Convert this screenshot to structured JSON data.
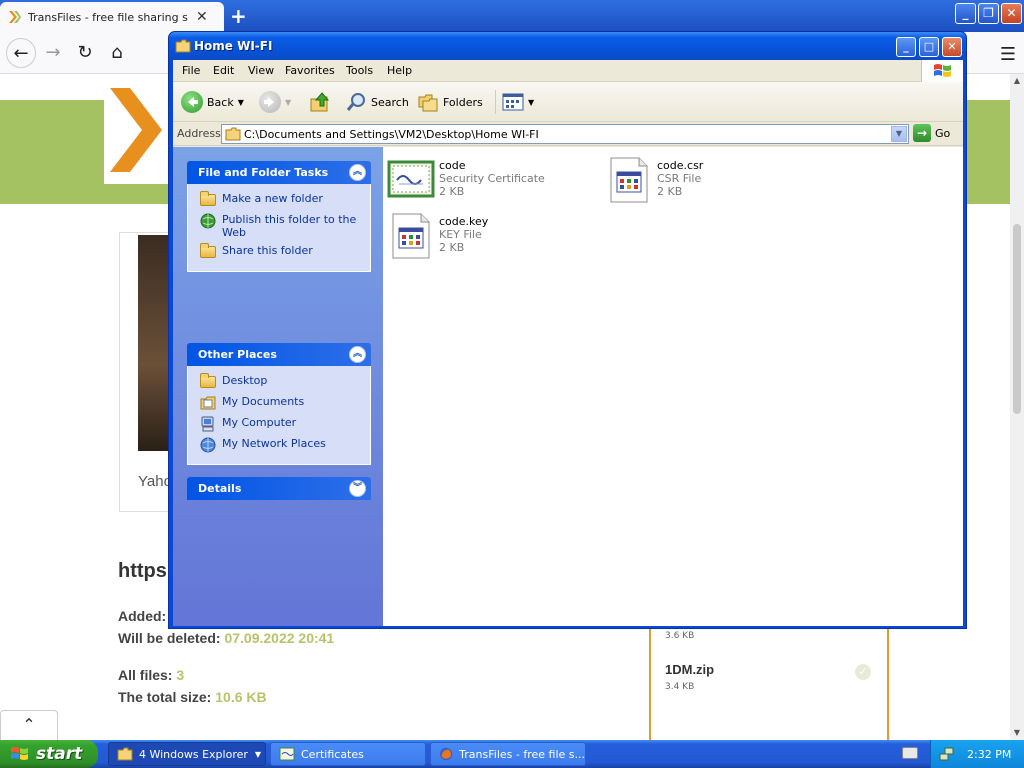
{
  "browser": {
    "tab_title": "TransFiles - free file sharing service",
    "new_tab": "+",
    "tab_close": "✕",
    "scroll_top_label": "⌃",
    "site": {
      "card_caption": "Yaho",
      "link_heading": "https",
      "added_label": "Added:",
      "deleted_label": "Will be deleted:",
      "deleted_value": "07.09.2022 20:41",
      "all_files_label": "All files:",
      "all_files_value": "3",
      "total_size_label": "The total size:",
      "total_size_value": "10.6 KB",
      "files": [
        {
          "size": "3.6 KB"
        },
        {
          "name": "1DM.zip",
          "size": "3.4 KB"
        }
      ]
    }
  },
  "explorer": {
    "title": "Home WI-FI",
    "menu": [
      "File",
      "Edit",
      "View",
      "Favorites",
      "Tools",
      "Help"
    ],
    "toolbar": {
      "back": "Back",
      "search": "Search",
      "folders": "Folders"
    },
    "address": {
      "label": "Address",
      "path": "C:\\Documents and Settings\\VM2\\Desktop\\Home WI-FI",
      "go": "Go"
    },
    "tasks": {
      "title": "File and Folder Tasks",
      "items": [
        "Make a new folder",
        "Publish this folder to the Web",
        "Share this folder"
      ]
    },
    "places": {
      "title": "Other Places",
      "items": [
        "Desktop",
        "My Documents",
        "My Computer",
        "My Network Places"
      ]
    },
    "details": {
      "title": "Details"
    },
    "files": [
      {
        "name": "code",
        "type": "Security Certificate",
        "size": "2 KB",
        "icon": "certificate-icon"
      },
      {
        "name": "code.csr",
        "type": "CSR File",
        "size": "2 KB",
        "icon": "generic-file-icon"
      },
      {
        "name": "code.key",
        "type": "KEY File",
        "size": "2 KB",
        "icon": "generic-file-icon"
      }
    ]
  },
  "taskbar": {
    "start": "start",
    "items": [
      {
        "label": "4 Windows Explorer",
        "active": true
      },
      {
        "label": "Certificates",
        "active": false
      },
      {
        "label": "TransFiles - free file s...",
        "active": false
      }
    ],
    "clock": "2:32 PM"
  },
  "colors": {
    "xp_blue": "#0a49d6",
    "taskpane_gradient_top": "#7ba2e7",
    "site_green": "#a5c263",
    "site_orange": "#e39a2e",
    "start_green": "#35a22d"
  }
}
